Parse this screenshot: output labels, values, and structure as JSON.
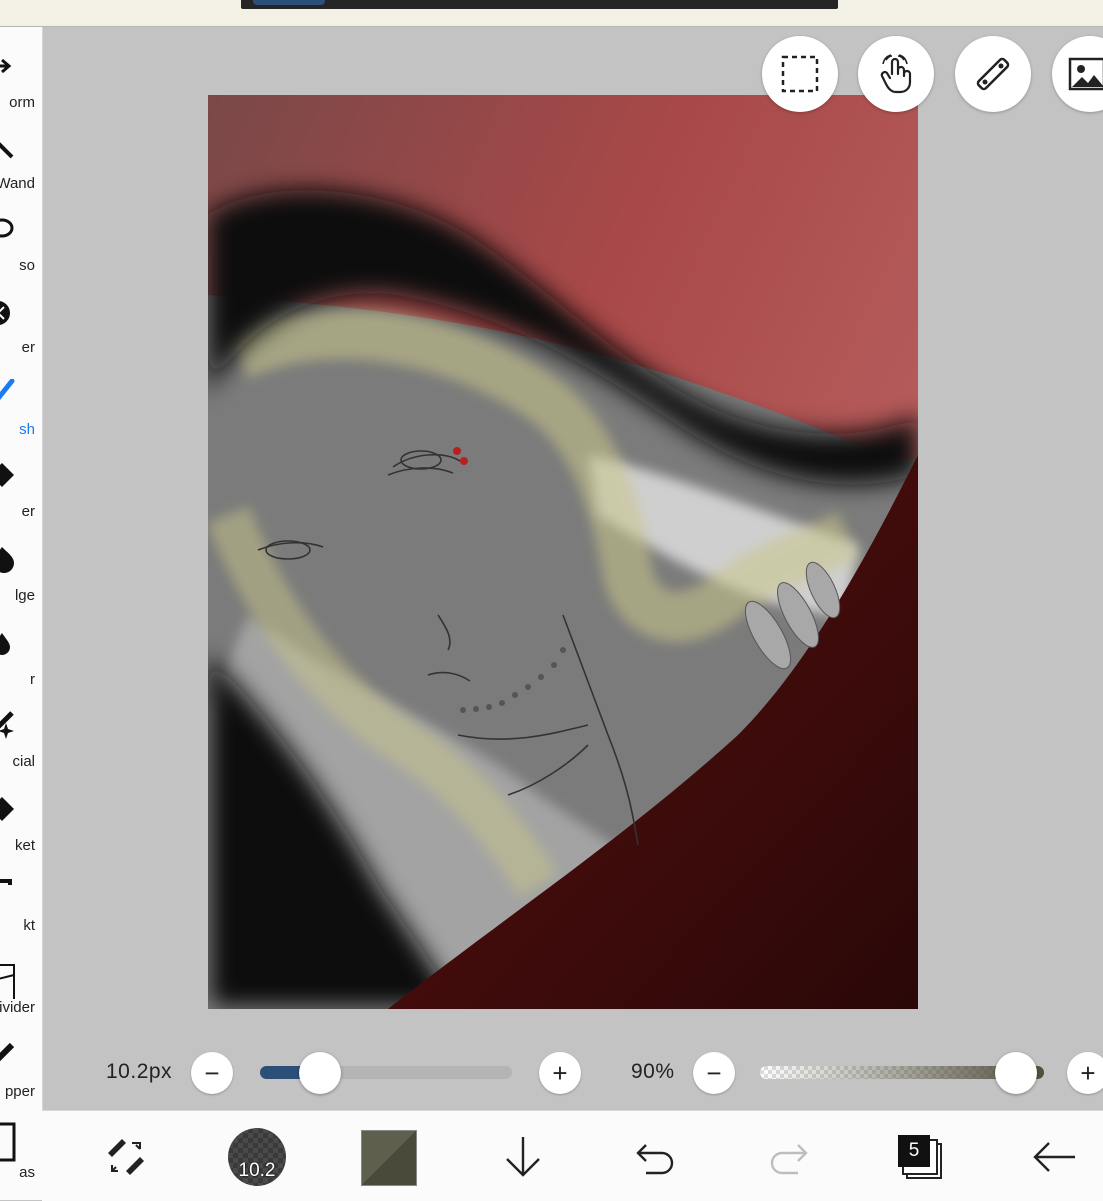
{
  "sidebar": {
    "tools": [
      {
        "label": "orm",
        "icon": "transform-icon",
        "active": false
      },
      {
        "label": "Wand",
        "icon": "magic-wand-icon",
        "active": false
      },
      {
        "label": "so",
        "icon": "lasso-icon",
        "active": false
      },
      {
        "label": "er",
        "icon": "filter-icon",
        "active": false
      },
      {
        "label": "sh",
        "icon": "brush-icon",
        "active": true
      },
      {
        "label": "er",
        "icon": "eraser-icon",
        "active": false
      },
      {
        "label": "lge",
        "icon": "smudge-icon",
        "active": false
      },
      {
        "label": "r",
        "icon": "blur-icon",
        "active": false
      },
      {
        "label": "cial",
        "icon": "special-brush-icon",
        "active": false
      },
      {
        "label": "ket",
        "icon": "bucket-icon",
        "active": false
      },
      {
        "label": "kt",
        "icon": "text-icon",
        "active": false
      },
      {
        "label": "ivider",
        "icon": "frame-divider-icon",
        "active": false
      },
      {
        "label": "pper",
        "icon": "eyedropper-icon",
        "active": false
      },
      {
        "label": "as",
        "icon": "canvas-icon",
        "active": false
      }
    ]
  },
  "floating_tools": [
    {
      "name": "selection-button",
      "icon": "dashed-selection-icon"
    },
    {
      "name": "gesture-button",
      "icon": "hand-touch-icon"
    },
    {
      "name": "ruler-button",
      "icon": "ruler-icon"
    },
    {
      "name": "image-button",
      "icon": "image-icon"
    }
  ],
  "brush_size": {
    "label": "10.2px",
    "value_fraction": 0.24,
    "minus": "−",
    "plus": "+"
  },
  "opacity": {
    "label": "90%",
    "value_fraction": 0.9,
    "minus": "−",
    "plus": "+"
  },
  "bottom_bar": {
    "brush_preview_value": "10.2",
    "layers_count": "5",
    "primary_color": "#4a4a3a",
    "secondary_color": "#5f5f4e"
  },
  "colors": {
    "accent": "#1a7cf0",
    "slider_fill": "#2c4f78",
    "slider_track": "#b4b4b4",
    "background": "#c3c3c3"
  }
}
